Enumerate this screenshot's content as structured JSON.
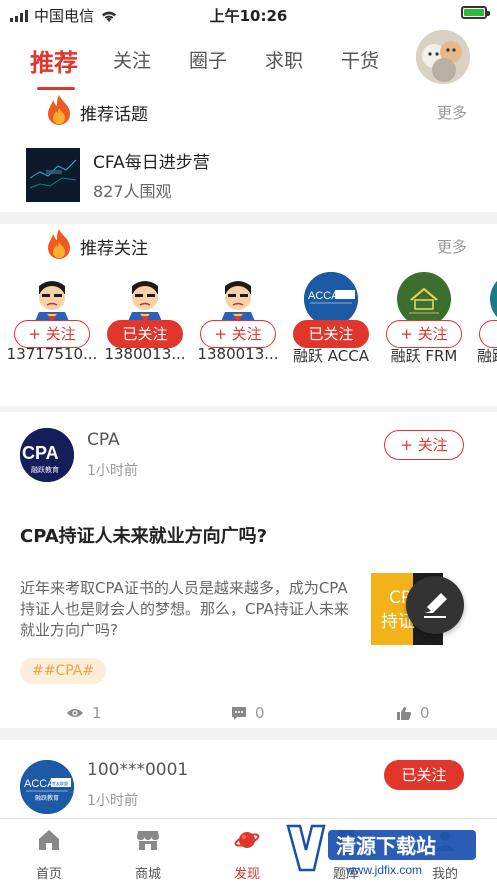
{
  "status_bar": {
    "carrier": "中国电信",
    "time": "上午10:26",
    "battery_percent": 80
  },
  "top_tabs": [
    {
      "label": "推荐",
      "active": true
    },
    {
      "label": "关注",
      "active": false
    },
    {
      "label": "圈子",
      "active": false
    },
    {
      "label": "求职",
      "active": false
    },
    {
      "label": "干货",
      "active": false
    }
  ],
  "topics_section": {
    "title": "推荐话题",
    "more": "更多",
    "topic": {
      "name": "CFA每日进步营",
      "count": "827人围观"
    }
  },
  "follow_section": {
    "title": "推荐关注",
    "more": "更多",
    "users": [
      {
        "name": "13717510...",
        "button": "+ 关注",
        "followed": false
      },
      {
        "name": "1380013...",
        "button": "已关注",
        "followed": true
      },
      {
        "name": "1380013...",
        "button": "+ 关注",
        "followed": false
      },
      {
        "name": "融跃 ACCA",
        "button": "已关注",
        "followed": true
      },
      {
        "name": "融跃 FRM",
        "button": "+ 关注",
        "followed": false
      },
      {
        "name": "融跃",
        "button": "+",
        "followed": false
      }
    ]
  },
  "post1": {
    "author": "CPA",
    "avatar_text": "CPA",
    "avatar_sub": "融跃教育",
    "time": "1小时前",
    "follow": "+ 关注",
    "title": "CPA持证人未来就业方向广吗?",
    "body": "近年来考取CPA证书的人员是越来越多，成为CPA持证人也是财会人的梦想。那么，CPA持证人未来就业方向广吗?",
    "image_text_1": "CPA",
    "image_text_2": "持证",
    "tag": "##CPA#",
    "views": "1",
    "comments": "0",
    "likes": "0"
  },
  "post2": {
    "author": "100***0001",
    "time": "1小时前",
    "follow": "已关注",
    "avatar_text": "ACCA",
    "avatar_badge": "考友联盟",
    "avatar_sub": "融跃教育"
  },
  "bottom_nav": [
    {
      "label": "首页",
      "icon": "home-icon",
      "active": false
    },
    {
      "label": "商城",
      "icon": "shop-icon",
      "active": false
    },
    {
      "label": "发现",
      "icon": "planet-icon",
      "active": true
    },
    {
      "label": "题库",
      "icon": "question-bank-icon",
      "active": false
    },
    {
      "label": "我的",
      "icon": "profile-icon",
      "active": false
    }
  ],
  "watermark": {
    "text": "清源下载站",
    "url": "www.jdfix.com"
  },
  "colors": {
    "accent": "#e0362c",
    "tag_bg": "#fdeedb",
    "tag_text": "#f0a23a",
    "acca_blue": "#1c5aa6",
    "frm_green": "#3c6e2f",
    "cpa_navy": "#141e5a"
  }
}
